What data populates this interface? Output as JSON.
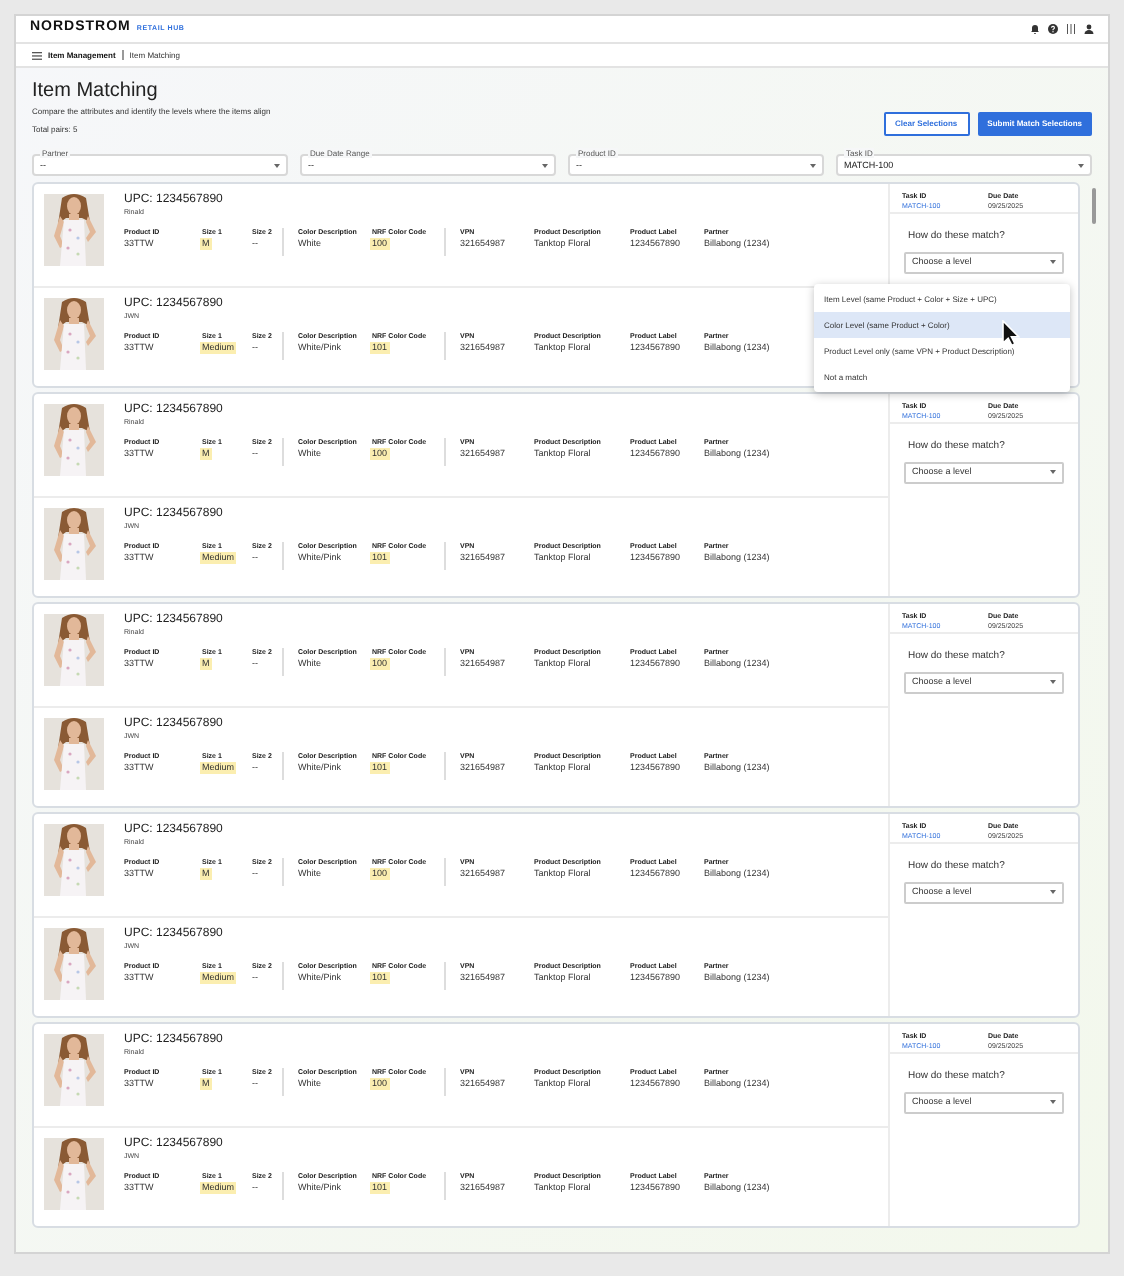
{
  "header": {
    "logo": "NORDSTROM",
    "product": "RETAIL HUB"
  },
  "breadcrumb": [
    {
      "label": "Item Management",
      "current": false
    },
    {
      "label": "Item Matching",
      "current": true
    }
  ],
  "page": {
    "title": "Item Matching",
    "subtitle": "Compare the attributes and identify the levels where the items align",
    "total": "Total pairs: 5"
  },
  "buttons": [
    {
      "label": "Clear Selections",
      "kind": "secondary"
    },
    {
      "label": "Submit Match Selections",
      "kind": "primary"
    }
  ],
  "filters": [
    {
      "label": "Partner",
      "value": "--"
    },
    {
      "label": "Due Date Range",
      "value": "--"
    },
    {
      "label": "Product ID",
      "value": "--"
    },
    {
      "label": "Task ID",
      "value": "MATCH-100"
    }
  ],
  "cards": [
    {
      "items": [
        {
          "upc": "UPC: 1234567890",
          "source": "Rinald",
          "groups": [
            [
              {
                "label": "Product ID",
                "value": "33TTW",
                "highlight": false
              },
              {
                "label": "Size 1",
                "value": "M",
                "highlight": true
              },
              {
                "label": "Size 2",
                "value": "--",
                "highlight": false
              }
            ],
            [
              {
                "label": "Color Description",
                "value": "White",
                "highlight": false
              },
              {
                "label": "NRF Color Code",
                "value": "100",
                "highlight": true
              }
            ],
            [
              {
                "label": "VPN",
                "value": "321654987",
                "highlight": false
              },
              {
                "label": "Product Description",
                "value": "Tanktop Floral",
                "highlight": false
              },
              {
                "label": "Product Label",
                "value": "1234567890",
                "highlight": false
              },
              {
                "label": "Partner",
                "value": "Billabong (1234)",
                "highlight": false
              }
            ]
          ]
        },
        {
          "upc": "UPC: 1234567890",
          "source": "JWN",
          "groups": [
            [
              {
                "label": "Product ID",
                "value": "33TTW",
                "highlight": false
              },
              {
                "label": "Size 1",
                "value": "Medium",
                "highlight": true
              },
              {
                "label": "Size 2",
                "value": "--",
                "highlight": false
              }
            ],
            [
              {
                "label": "Color Description",
                "value": "White/Pink",
                "highlight": false
              },
              {
                "label": "NRF Color Code",
                "value": "101",
                "highlight": true
              }
            ],
            [
              {
                "label": "VPN",
                "value": "321654987",
                "highlight": false
              },
              {
                "label": "Product Description",
                "value": "Tanktop Floral",
                "highlight": false
              },
              {
                "label": "Product Label",
                "value": "1234567890",
                "highlight": false
              },
              {
                "label": "Partner",
                "value": "Billabong (1234)",
                "highlight": false
              }
            ]
          ]
        }
      ],
      "task_label": "Task ID",
      "task_id": "MATCH-100",
      "due_label": "Due Date",
      "due_date": "09/25/2025",
      "question": "How do these match?",
      "select": "Choose a level",
      "menu": [
        {
          "label": "Item Level (same Product + Color + Size + UPC)",
          "selected": false
        },
        {
          "label": "Color Level (same Product + Color)",
          "selected": true
        },
        {
          "label": "Product Level only (same VPN + Product Description)",
          "selected": false
        },
        {
          "label": "Not a match",
          "selected": false
        }
      ]
    },
    {
      "items": [
        {
          "upc": "UPC: 1234567890",
          "source": "Rinald",
          "groups": [
            [
              {
                "label": "Product ID",
                "value": "33TTW",
                "highlight": false
              },
              {
                "label": "Size 1",
                "value": "M",
                "highlight": true
              },
              {
                "label": "Size 2",
                "value": "--",
                "highlight": false
              }
            ],
            [
              {
                "label": "Color Description",
                "value": "White",
                "highlight": false
              },
              {
                "label": "NRF Color Code",
                "value": "100",
                "highlight": true
              }
            ],
            [
              {
                "label": "VPN",
                "value": "321654987",
                "highlight": false
              },
              {
                "label": "Product Description",
                "value": "Tanktop Floral",
                "highlight": false
              },
              {
                "label": "Product Label",
                "value": "1234567890",
                "highlight": false
              },
              {
                "label": "Partner",
                "value": "Billabong (1234)",
                "highlight": false
              }
            ]
          ]
        },
        {
          "upc": "UPC: 1234567890",
          "source": "JWN",
          "groups": [
            [
              {
                "label": "Product ID",
                "value": "33TTW",
                "highlight": false
              },
              {
                "label": "Size 1",
                "value": "Medium",
                "highlight": true
              },
              {
                "label": "Size 2",
                "value": "--",
                "highlight": false
              }
            ],
            [
              {
                "label": "Color Description",
                "value": "White/Pink",
                "highlight": false
              },
              {
                "label": "NRF Color Code",
                "value": "101",
                "highlight": true
              }
            ],
            [
              {
                "label": "VPN",
                "value": "321654987",
                "highlight": false
              },
              {
                "label": "Product Description",
                "value": "Tanktop Floral",
                "highlight": false
              },
              {
                "label": "Product Label",
                "value": "1234567890",
                "highlight": false
              },
              {
                "label": "Partner",
                "value": "Billabong (1234)",
                "highlight": false
              }
            ]
          ]
        }
      ],
      "task_label": "Task ID",
      "task_id": "MATCH-100",
      "due_label": "Due Date",
      "due_date": "09/25/2025",
      "question": "How do these match?",
      "select": "Choose a level"
    },
    {
      "items": [
        {
          "upc": "UPC: 1234567890",
          "source": "Rinald",
          "groups": [
            [
              {
                "label": "Product ID",
                "value": "33TTW",
                "highlight": false
              },
              {
                "label": "Size 1",
                "value": "M",
                "highlight": true
              },
              {
                "label": "Size 2",
                "value": "--",
                "highlight": false
              }
            ],
            [
              {
                "label": "Color Description",
                "value": "White",
                "highlight": false
              },
              {
                "label": "NRF Color Code",
                "value": "100",
                "highlight": true
              }
            ],
            [
              {
                "label": "VPN",
                "value": "321654987",
                "highlight": false
              },
              {
                "label": "Product Description",
                "value": "Tanktop Floral",
                "highlight": false
              },
              {
                "label": "Product Label",
                "value": "1234567890",
                "highlight": false
              },
              {
                "label": "Partner",
                "value": "Billabong (1234)",
                "highlight": false
              }
            ]
          ]
        },
        {
          "upc": "UPC: 1234567890",
          "source": "JWN",
          "groups": [
            [
              {
                "label": "Product ID",
                "value": "33TTW",
                "highlight": false
              },
              {
                "label": "Size 1",
                "value": "Medium",
                "highlight": true
              },
              {
                "label": "Size 2",
                "value": "--",
                "highlight": false
              }
            ],
            [
              {
                "label": "Color Description",
                "value": "White/Pink",
                "highlight": false
              },
              {
                "label": "NRF Color Code",
                "value": "101",
                "highlight": true
              }
            ],
            [
              {
                "label": "VPN",
                "value": "321654987",
                "highlight": false
              },
              {
                "label": "Product Description",
                "value": "Tanktop Floral",
                "highlight": false
              },
              {
                "label": "Product Label",
                "value": "1234567890",
                "highlight": false
              },
              {
                "label": "Partner",
                "value": "Billabong (1234)",
                "highlight": false
              }
            ]
          ]
        }
      ],
      "task_label": "Task ID",
      "task_id": "MATCH-100",
      "due_label": "Due Date",
      "due_date": "09/25/2025",
      "question": "How do these match?",
      "select": "Choose a level"
    },
    {
      "items": [
        {
          "upc": "UPC: 1234567890",
          "source": "Rinald",
          "groups": [
            [
              {
                "label": "Product ID",
                "value": "33TTW",
                "highlight": false
              },
              {
                "label": "Size 1",
                "value": "M",
                "highlight": true
              },
              {
                "label": "Size 2",
                "value": "--",
                "highlight": false
              }
            ],
            [
              {
                "label": "Color Description",
                "value": "White",
                "highlight": false
              },
              {
                "label": "NRF Color Code",
                "value": "100",
                "highlight": true
              }
            ],
            [
              {
                "label": "VPN",
                "value": "321654987",
                "highlight": false
              },
              {
                "label": "Product Description",
                "value": "Tanktop Floral",
                "highlight": false
              },
              {
                "label": "Product Label",
                "value": "1234567890",
                "highlight": false
              },
              {
                "label": "Partner",
                "value": "Billabong (1234)",
                "highlight": false
              }
            ]
          ]
        },
        {
          "upc": "UPC: 1234567890",
          "source": "JWN",
          "groups": [
            [
              {
                "label": "Product ID",
                "value": "33TTW",
                "highlight": false
              },
              {
                "label": "Size 1",
                "value": "Medium",
                "highlight": true
              },
              {
                "label": "Size 2",
                "value": "--",
                "highlight": false
              }
            ],
            [
              {
                "label": "Color Description",
                "value": "White/Pink",
                "highlight": false
              },
              {
                "label": "NRF Color Code",
                "value": "101",
                "highlight": true
              }
            ],
            [
              {
                "label": "VPN",
                "value": "321654987",
                "highlight": false
              },
              {
                "label": "Product Description",
                "value": "Tanktop Floral",
                "highlight": false
              },
              {
                "label": "Product Label",
                "value": "1234567890",
                "highlight": false
              },
              {
                "label": "Partner",
                "value": "Billabong (1234)",
                "highlight": false
              }
            ]
          ]
        }
      ],
      "task_label": "Task ID",
      "task_id": "MATCH-100",
      "due_label": "Due Date",
      "due_date": "09/25/2025",
      "question": "How do these match?",
      "select": "Choose a level"
    },
    {
      "items": [
        {
          "upc": "UPC: 1234567890",
          "source": "Rinald",
          "groups": [
            [
              {
                "label": "Product ID",
                "value": "33TTW",
                "highlight": false
              },
              {
                "label": "Size 1",
                "value": "M",
                "highlight": true
              },
              {
                "label": "Size 2",
                "value": "--",
                "highlight": false
              }
            ],
            [
              {
                "label": "Color Description",
                "value": "White",
                "highlight": false
              },
              {
                "label": "NRF Color Code",
                "value": "100",
                "highlight": true
              }
            ],
            [
              {
                "label": "VPN",
                "value": "321654987",
                "highlight": false
              },
              {
                "label": "Product Description",
                "value": "Tanktop Floral",
                "highlight": false
              },
              {
                "label": "Product Label",
                "value": "1234567890",
                "highlight": false
              },
              {
                "label": "Partner",
                "value": "Billabong (1234)",
                "highlight": false
              }
            ]
          ]
        },
        {
          "upc": "UPC: 1234567890",
          "source": "JWN",
          "groups": [
            [
              {
                "label": "Product ID",
                "value": "33TTW",
                "highlight": false
              },
              {
                "label": "Size 1",
                "value": "Medium",
                "highlight": true
              },
              {
                "label": "Size 2",
                "value": "--",
                "highlight": false
              }
            ],
            [
              {
                "label": "Color Description",
                "value": "White/Pink",
                "highlight": false
              },
              {
                "label": "NRF Color Code",
                "value": "101",
                "highlight": true
              }
            ],
            [
              {
                "label": "VPN",
                "value": "321654987",
                "highlight": false
              },
              {
                "label": "Product Description",
                "value": "Tanktop Floral",
                "highlight": false
              },
              {
                "label": "Product Label",
                "value": "1234567890",
                "highlight": false
              },
              {
                "label": "Partner",
                "value": "Billabong (1234)",
                "highlight": false
              }
            ]
          ]
        }
      ],
      "task_label": "Task ID",
      "task_id": "MATCH-100",
      "due_label": "Due Date",
      "due_date": "09/25/2025",
      "question": "How do these match?",
      "select": "Choose a level"
    }
  ]
}
